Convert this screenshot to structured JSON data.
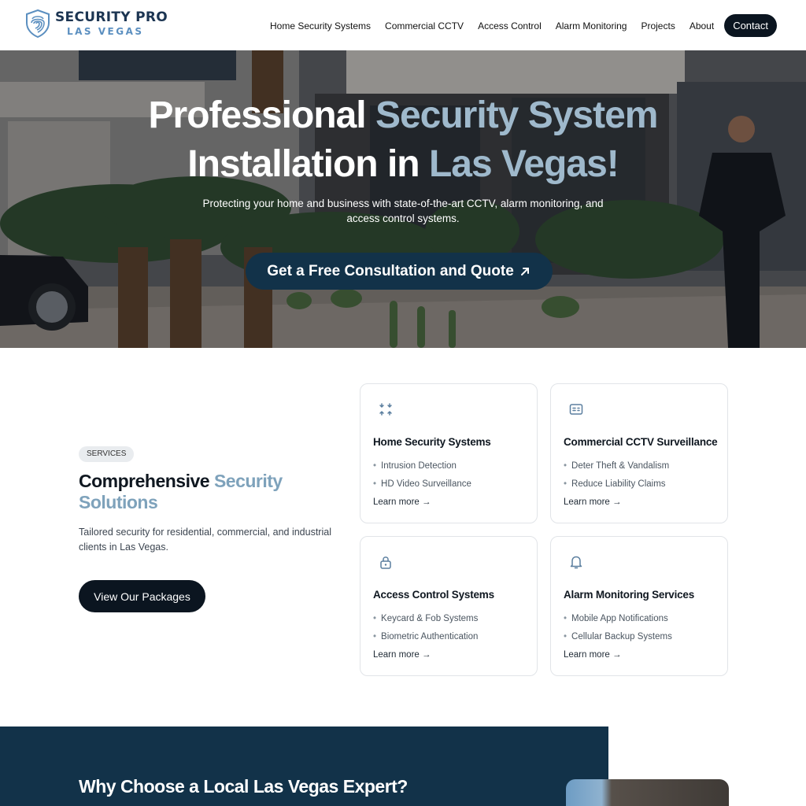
{
  "brand": {
    "title": "SECURITY PRO",
    "subtitle": "LAS VEGAS",
    "accent_color": "#5b8fc0",
    "primary_color": "#123249"
  },
  "nav": {
    "items": [
      "Home Security Systems",
      "Commercial CCTV",
      "Access Control",
      "Alarm Monitoring",
      "Projects",
      "About"
    ],
    "contact_label": "Contact"
  },
  "hero": {
    "title_part1": "Professional ",
    "title_accent1": "Security System",
    "title_part2": "Installation in ",
    "title_accent2": "Las Vegas!",
    "subtitle": "Protecting your home and business with state-of-the-art CCTV, alarm monitoring, and access control systems.",
    "cta_label": "Get a Free Consultation and Quote",
    "cta_icon": "arrow-up-right-icon"
  },
  "services": {
    "badge": "SERVICES",
    "heading_part1": "Comprehensive ",
    "heading_accent": "Security Solutions",
    "description": "Tailored security for residential, commercial, and industrial clients in Las Vegas.",
    "button_label": "View Our Packages",
    "cards": [
      {
        "icon": "compress-arrows-icon",
        "title": "Home Security Systems",
        "items": [
          "Intrusion Detection",
          "HD Video Surveillance"
        ],
        "link": "Learn more →"
      },
      {
        "icon": "dvr-box-icon",
        "title": "Commercial CCTV Surveillance",
        "items": [
          "Deter Theft & Vandalism",
          "Reduce Liability Claims"
        ],
        "link": "Learn more →"
      },
      {
        "icon": "lock-icon",
        "title": "Access Control Systems",
        "items": [
          "Keycard & Fob Systems",
          "Biometric Authentication"
        ],
        "link": "Learn more →"
      },
      {
        "icon": "bell-icon",
        "title": "Alarm Monitoring Services",
        "items": [
          "Mobile App Notifications",
          "Cellular Backup Systems"
        ],
        "link": "Learn more →"
      }
    ]
  },
  "why": {
    "title": "Why Choose a Local Las Vegas Expert?"
  }
}
